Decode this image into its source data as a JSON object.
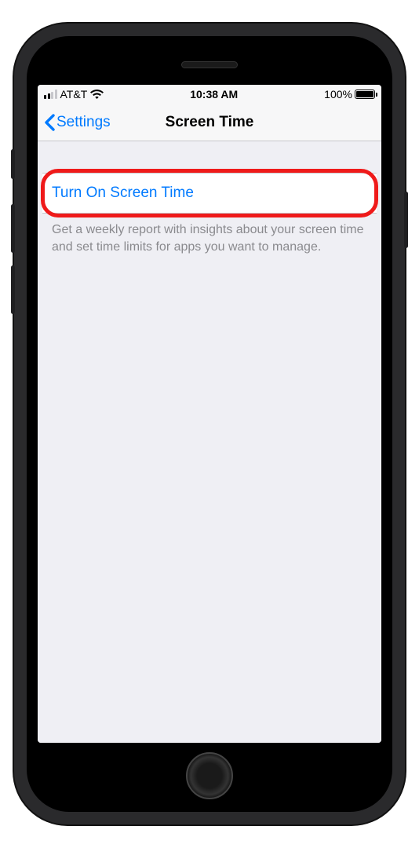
{
  "status_bar": {
    "carrier": "AT&T",
    "time": "10:38 AM",
    "battery_percent": "100%"
  },
  "nav": {
    "back_label": "Settings",
    "title": "Screen Time"
  },
  "main": {
    "action_label": "Turn On Screen Time",
    "description": "Get a weekly report with insights about your screen time and set time limits for apps you want to manage."
  }
}
